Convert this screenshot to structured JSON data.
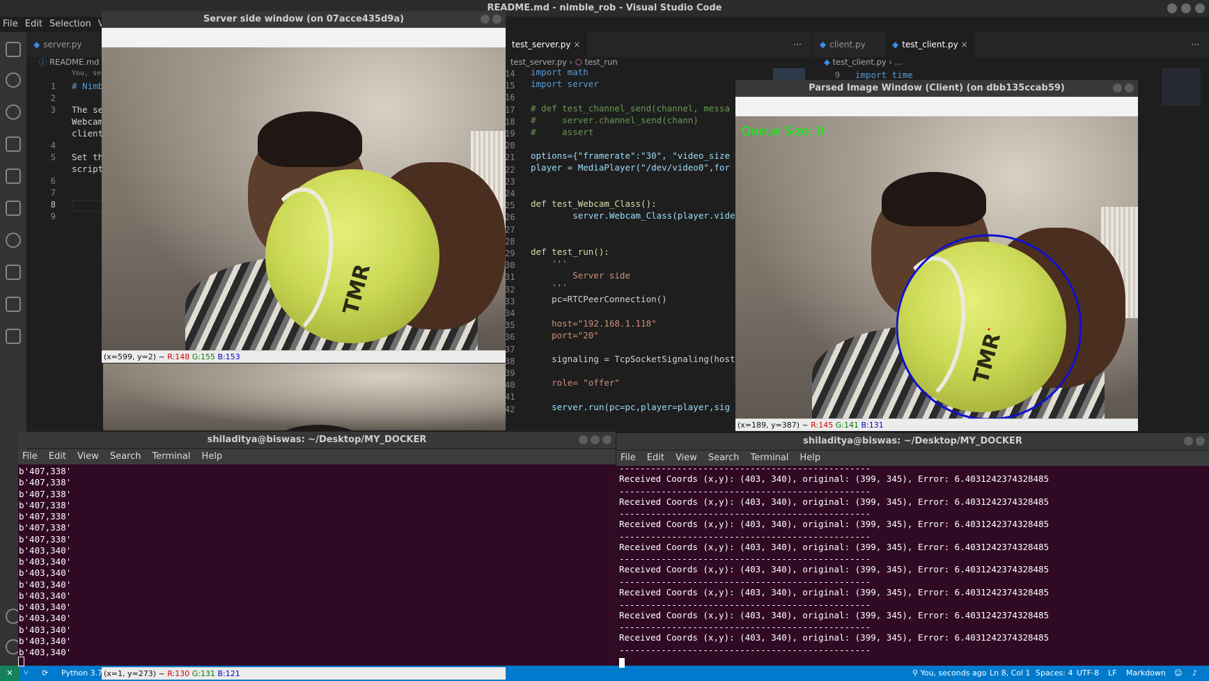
{
  "vscode": {
    "title": "README.md - nimble_rob - Visual Studio Code",
    "menu": [
      "File",
      "Edit",
      "Selection",
      "V"
    ],
    "left_pane": {
      "tab": "server.py",
      "breadcrumb": "README.md",
      "blame": "You, seco",
      "line_numbers": [
        "1",
        "2",
        "3",
        "",
        "",
        "4",
        "5",
        "",
        "6",
        "7",
        "8",
        "9"
      ],
      "lines": [
        "# Nimb",
        "",
        "The se",
        "Webcam",
        "client",
        "",
        "Set th",
        "script",
        "",
        "",
        "",
        ""
      ]
    },
    "mid_pane": {
      "tab": "test_server.py",
      "breadcrumb_file": "test_server.py",
      "breadcrumb_symbol": "test_run",
      "line_numbers": [
        "14",
        "15",
        "16",
        "17",
        "18",
        "19",
        "20",
        "21",
        "22",
        "23",
        "24",
        "25",
        "26",
        "27",
        "28",
        "29",
        "30",
        "31",
        "32",
        "33",
        "34",
        "35",
        "36",
        "37",
        "38",
        "39",
        "40",
        "41",
        "42"
      ],
      "code": {
        "l14": "import math",
        "l15": "import server",
        "l17": "# def test_channel_send(channel, messa",
        "l18": "#     server.channel_send(chann)",
        "l19": "#     assert",
        "l21": "options={\"framerate\":\"30\", \"video_size",
        "l22": "player = MediaPlayer(\"/dev/video0\",for",
        "l25": "def test_Webcam_Class():",
        "l26": "        server.Webcam_Class(player.vide",
        "l29": "def test_run():",
        "l30": "    '''",
        "l31": "        Server side",
        "l32": "    '''",
        "l33": "    pc=RTCPeerConnection()",
        "l35": "    host=\"192.168.1.118\"",
        "l36": "    port=\"20\"",
        "l38": "    signaling = TcpSocketSignaling(host",
        "l40": "    role= \"offer\"",
        "l42": "    server.run(pc=pc,player=player,sig"
      }
    },
    "right_pane": {
      "tabs": [
        "client.py",
        "test_client.py"
      ],
      "breadcrumb_file": "test_client.py",
      "breadcrumb_rest": "...",
      "line9_num": "9",
      "line9": "import time"
    },
    "more_actions": "···",
    "statusbar": {
      "python": "Python 3.7",
      "blame": "You, seconds ago",
      "position": "Ln 8, Col 1",
      "spaces": "Spaces: 4",
      "encoding": "UTF-8",
      "eol": "LF",
      "language": "Markdown"
    }
  },
  "server_window": {
    "title": "Server side window (on 07acce435d9a)",
    "status": {
      "coords": "(x=599, y=2) ~",
      "r": "R:148",
      "g": "G:155",
      "b": "B:153"
    },
    "status2": {
      "coords": "(x=1, y=273) ~",
      "r": "R:130",
      "g": "G:131",
      "b": "B:121"
    },
    "brand_text": "TMR"
  },
  "client_window": {
    "title": "Parsed Image Window (Client) (on dbb135ccab59)",
    "overlay": "Queue Size: 0",
    "status": {
      "coords": "(x=189, y=387) ~",
      "r": "R:145",
      "g": "G:141",
      "b": "B:131"
    },
    "circle_color": "#1010d0",
    "overlay_color": "#00ff00",
    "brand_text": "TMR"
  },
  "terminal_left": {
    "title": "shiladitya@biswas: ~/Desktop/MY_DOCKER",
    "menu": [
      "File",
      "Edit",
      "View",
      "Search",
      "Terminal",
      "Help"
    ],
    "lines": [
      "b'407,338'",
      "b'407,338'",
      "b'407,338'",
      "b'407,338'",
      "b'407,338'",
      "b'407,338'",
      "b'407,338'",
      "b'403,340'",
      "b'403,340'",
      "b'403,340'",
      "b'403,340'",
      "b'403,340'",
      "b'403,340'",
      "b'403,340'",
      "b'403,340'",
      "b'403,340'",
      "b'403,340'"
    ]
  },
  "terminal_right": {
    "title": "shiladitya@biswas: ~/Desktop/MY_DOCKER",
    "menu": [
      "File",
      "Edit",
      "View",
      "Search",
      "Terminal",
      "Help"
    ],
    "separator": "------------------------------------------------",
    "line": "Received Coords (x,y): (403, 340), original: (399, 345), Error: 6.4031242374328485",
    "repeat": 8
  }
}
